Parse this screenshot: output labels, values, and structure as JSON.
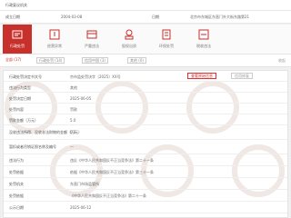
{
  "top_rows": {
    "row1_label": "行政复议机关",
    "row2_label": "成立日期",
    "row2_value": "2004-03-08",
    "row2_label2": "日期",
    "row2_value2": "北京市东城区东直门外大街东路第21"
  },
  "tabs": [
    {
      "label": "行政处罚",
      "icon": "gavel-icon",
      "active": true
    },
    {
      "label": "经营异常",
      "icon": "warning-icon",
      "active": false
    },
    {
      "label": "严重违法",
      "icon": "blacklist-icon",
      "active": false
    },
    {
      "label": "股权出质",
      "icon": "stamp-icon",
      "active": false
    },
    {
      "label": "环保处罚",
      "icon": "document-icon",
      "active": false
    },
    {
      "label": "税收违法",
      "icon": "tax-icon",
      "active": false
    }
  ],
  "filters": [
    {
      "label": "全部 (17)"
    },
    {
      "label": "行政处罚 (14)"
    },
    {
      "label": "信用中国 (3)"
    },
    {
      "label": "其他 (0)"
    }
  ],
  "filter_right": "收起",
  "list": {
    "rows": [
      {
        "label": "行政处罚决定书文号",
        "value": "京市监处罚决字〔2025〕XX号"
      },
      {
        "label": "违法行为类型",
        "value": "其他"
      },
      {
        "label": "处罚决定日期",
        "value": "2025-06-05"
      },
      {
        "label": "处罚内容",
        "value": "罚款"
      },
      {
        "label": "罚款金额（万元）",
        "value": "5.0"
      },
      {
        "label": "没收违法所得、没收非法财物的金额（万元）",
        "value": "0.0"
      },
      {
        "label": "暂扣或者吊销证照名称及编号",
        "value": "—"
      },
      {
        "label": "违法行为",
        "value": "违反《中华人民共和国反不正当竞争法》第二十一条"
      },
      {
        "label": "处罚依据",
        "value": "依据《中华人民共和国反不正当竞争法》第三十一条"
      },
      {
        "label": "处罚机关",
        "value": "东直门市场监管所"
      },
      {
        "label": "处罚依据",
        "value": "《中华人民共和国反不正当竞争法》第二十一条"
      },
      {
        "label": "公示日期",
        "value": "2025-06-12"
      }
    ],
    "btn_detail": "查看原始信息",
    "btn_more": "信用修复"
  }
}
